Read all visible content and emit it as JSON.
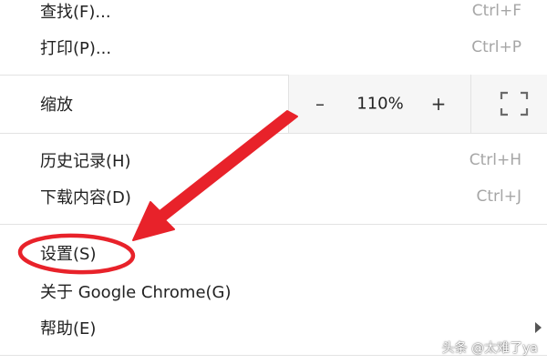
{
  "menu": {
    "find": {
      "label": "查找(F)...",
      "shortcut": "Ctrl+F"
    },
    "print": {
      "label": "打印(P)...",
      "shortcut": "Ctrl+P"
    },
    "zoom": {
      "label": "缩放",
      "minus": "–",
      "value": "110%",
      "plus": "+"
    },
    "history": {
      "label": "历史记录(H)",
      "shortcut": "Ctrl+H"
    },
    "downloads": {
      "label": "下载内容(D)",
      "shortcut": "Ctrl+J"
    },
    "settings": {
      "label": "设置(S)"
    },
    "about": {
      "label": "关于 Google Chrome(G)"
    },
    "help": {
      "label": "帮助(E)"
    }
  },
  "icons": {
    "fullscreen": "fullscreen-icon",
    "submenu": "chevron-right-icon"
  },
  "annotation": {
    "color": "#e8222a"
  },
  "watermark": "头条 @太难了ya"
}
